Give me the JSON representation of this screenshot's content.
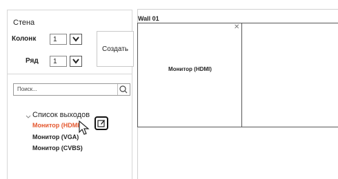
{
  "panel": {
    "title": "Стена",
    "columns_label": "Колонк",
    "columns_value": "1",
    "rows_label": "Ряд",
    "rows_value": "1",
    "create_button": "Создать"
  },
  "search": {
    "placeholder": "Поиск..."
  },
  "outputs": {
    "root_label": "Список выходов",
    "items": [
      {
        "label": "Монитор (HDMI)",
        "active": true
      },
      {
        "label": "Монитор (VGA)",
        "active": false
      },
      {
        "label": "Монитор (CVBS)",
        "active": false
      }
    ]
  },
  "wall": {
    "title": "Wall 01",
    "cells": [
      {
        "label": "Монитор (HDMI)"
      }
    ]
  },
  "icons": [
    "chevron-down-icon",
    "search-icon",
    "edit-icon",
    "close-icon",
    "mouse-pointer-icon"
  ],
  "colors": {
    "active_item": "#e4572e",
    "text": "#222222",
    "border": "#d6d6d6"
  }
}
